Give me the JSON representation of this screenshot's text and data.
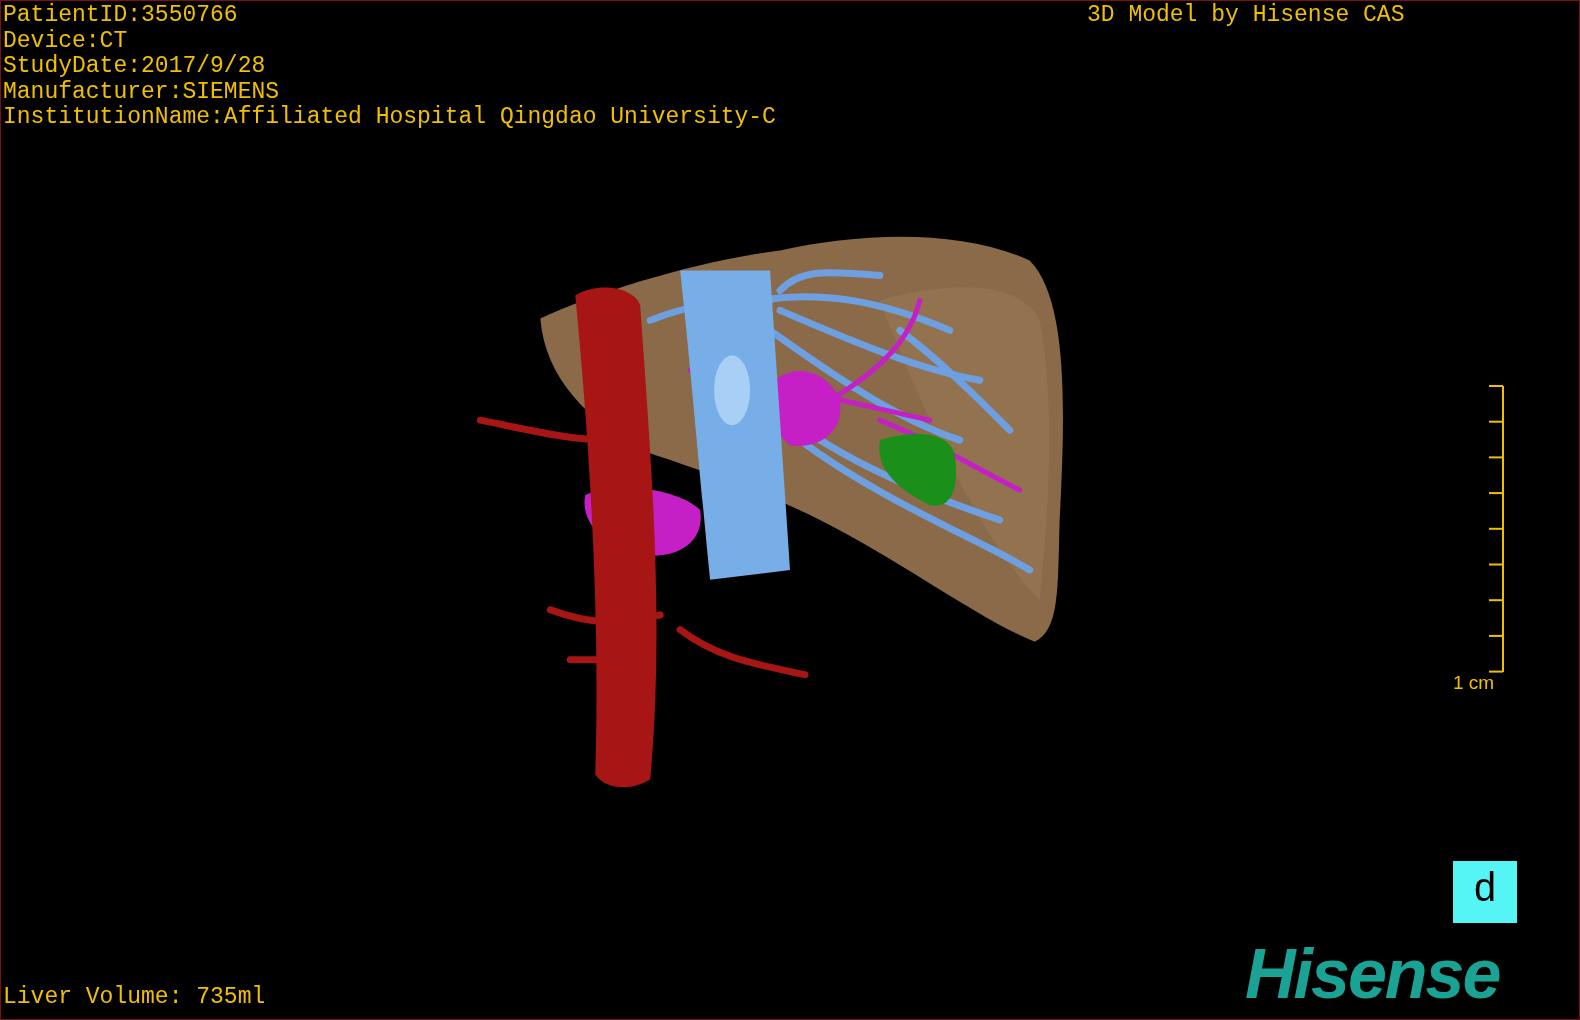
{
  "patient_info": [
    "PatientID:3550766",
    "Device:CT",
    "StudyDate:2017/9/28",
    "Manufacturer:SIEMENS",
    "InstitutionName:Affiliated Hospital Qingdao University-C"
  ],
  "title": "3D Model by Hisense CAS",
  "scale_bar": {
    "label": "1 cm"
  },
  "orientation_marker": "d",
  "logo": "Hisense",
  "liver_volume": "Liver Volume: 735ml"
}
